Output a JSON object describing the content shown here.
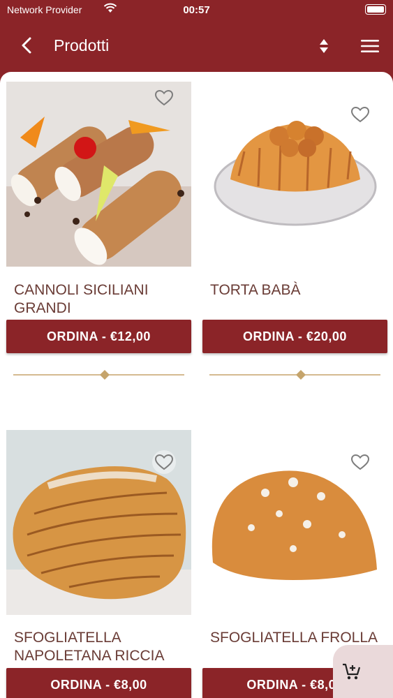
{
  "status_bar": {
    "carrier": "Network Provider",
    "time": "00:57"
  },
  "header": {
    "title": "Prodotti"
  },
  "icons": {
    "back": "chevron-left-icon",
    "sort": "sort-icon",
    "menu": "hamburger-menu-icon",
    "favorite": "heart-outline-icon",
    "cart": "add-to-cart-icon"
  },
  "colors": {
    "primary": "#8b2428",
    "name_text": "#6a3c36",
    "divider": "#c5a46b",
    "fab_bg": "#ead9da"
  },
  "products": [
    {
      "name": "CANNOLI SICILIANI GRANDI",
      "button": "ORDINA - €12,00"
    },
    {
      "name": "TORTA BABÀ",
      "button": "ORDINA - €20,00"
    },
    {
      "name": "SFOGLIATELLA NAPOLETANA RICCIA",
      "button": "ORDINA - €8,00"
    },
    {
      "name": "SFOGLIATELLA FROLLA",
      "button": "ORDINA - €8,00"
    }
  ]
}
